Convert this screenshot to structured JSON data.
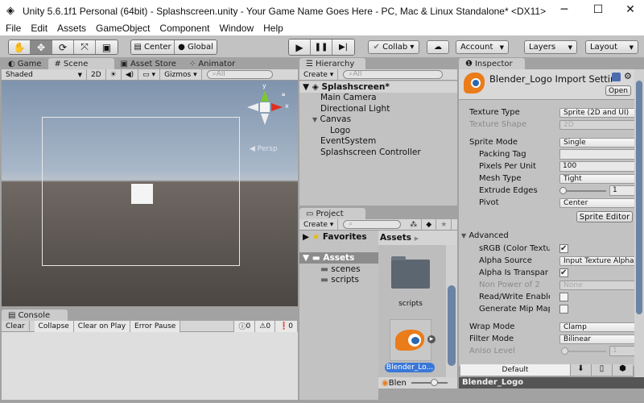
{
  "window": {
    "title": "Unity 5.6.1f1 Personal (64bit) - Splashscreen.unity - Your Game Name Goes Here - PC, Mac & Linux Standalone* <DX11>",
    "minimize": "─",
    "maximize": "☐",
    "close": "✕"
  },
  "menu": [
    "File",
    "Edit",
    "Assets",
    "GameObject",
    "Component",
    "Window",
    "Help"
  ],
  "toolbar": {
    "tools": [
      "✋",
      "✥",
      "⟳",
      "⤧",
      "▣"
    ],
    "active_tool": 1,
    "pivot": "Center",
    "space": "Global",
    "play": "▶",
    "pause": "❚❚",
    "step": "▶|",
    "collab": "Collab ▾",
    "cloud": "☁",
    "account": "Account",
    "layers": "Layers",
    "layout": "Layout"
  },
  "scene": {
    "tabs": [
      "Game",
      "Scene",
      "Asset Store",
      "Animator"
    ],
    "active_tab": 1,
    "shading": "Shaded",
    "mode_2d": "2D",
    "gizmos": "Gizmos",
    "search_placeholder": "All",
    "persp": "Persp",
    "axis_x": "x",
    "axis_y": "y"
  },
  "console": {
    "tab": "Console",
    "buttons": [
      "Clear",
      "Collapse",
      "Clear on Play",
      "Error Pause"
    ],
    "info_count": "0",
    "warning_count": "0",
    "error_count": "0"
  },
  "hierarchy": {
    "tab": "Hierarchy",
    "create": "Create",
    "search_placeholder": "All",
    "scene_name": "Splashscreen*",
    "items": [
      {
        "label": "Main Camera",
        "depth": 1
      },
      {
        "label": "Directional Light",
        "depth": 1
      },
      {
        "label": "Canvas",
        "depth": 1,
        "expanded": true
      },
      {
        "label": "Logo",
        "depth": 2
      },
      {
        "label": "EventSystem",
        "depth": 1
      },
      {
        "label": "Splashscreen Controller",
        "depth": 1
      }
    ]
  },
  "project": {
    "tab": "Project",
    "create": "Create",
    "favorites": "Favorites",
    "assets": "Assets",
    "folders": [
      "scenes",
      "scripts"
    ],
    "breadcrumb": "Assets",
    "grid_items": [
      {
        "label": "scripts",
        "type": "folder"
      },
      {
        "label": "Blender_Lo...",
        "type": "image",
        "selected": true
      }
    ],
    "footer_label": "Blen"
  },
  "inspector": {
    "tab": "Inspector",
    "title": "Blender_Logo Import Settir",
    "open": "Open",
    "rows": [
      {
        "label": "Texture Type",
        "value": "Sprite (2D and UI)",
        "kind": "dropdown"
      },
      {
        "label": "Texture Shape",
        "value": "2D",
        "kind": "dropdown",
        "disabled": true
      },
      {
        "label": "Sprite Mode",
        "value": "Single",
        "kind": "dropdown"
      },
      {
        "label": "Packing Tag",
        "value": "",
        "kind": "field"
      },
      {
        "label": "Pixels Per Unit",
        "value": "100",
        "kind": "field"
      },
      {
        "label": "Mesh Type",
        "value": "Tight",
        "kind": "dropdown"
      },
      {
        "label": "Extrude Edges",
        "value": "1",
        "kind": "slider"
      },
      {
        "label": "Pivot",
        "value": "Center",
        "kind": "dropdown"
      }
    ],
    "sprite_editor": "Sprite Editor",
    "advanced": "Advanced",
    "advanced_rows": [
      {
        "label": "sRGB (Color Textu",
        "value": true,
        "kind": "check"
      },
      {
        "label": "Alpha Source",
        "value": "Input Texture Alpha",
        "kind": "dropdown"
      },
      {
        "label": "Alpha Is Transpar",
        "value": true,
        "kind": "check"
      },
      {
        "label": "Non Power of 2",
        "value": "None",
        "kind": "dropdown",
        "disabled": true
      },
      {
        "label": "Read/Write Enable",
        "value": false,
        "kind": "check"
      },
      {
        "label": "Generate Mip Map",
        "value": false,
        "kind": "check"
      }
    ],
    "wrap_mode": {
      "label": "Wrap Mode",
      "value": "Clamp"
    },
    "filter_mode": {
      "label": "Filter Mode",
      "value": "Bilinear"
    },
    "aniso": {
      "label": "Aniso Level",
      "value": "1"
    },
    "platform_default": "Default",
    "preview_label": "Blender_Logo"
  }
}
